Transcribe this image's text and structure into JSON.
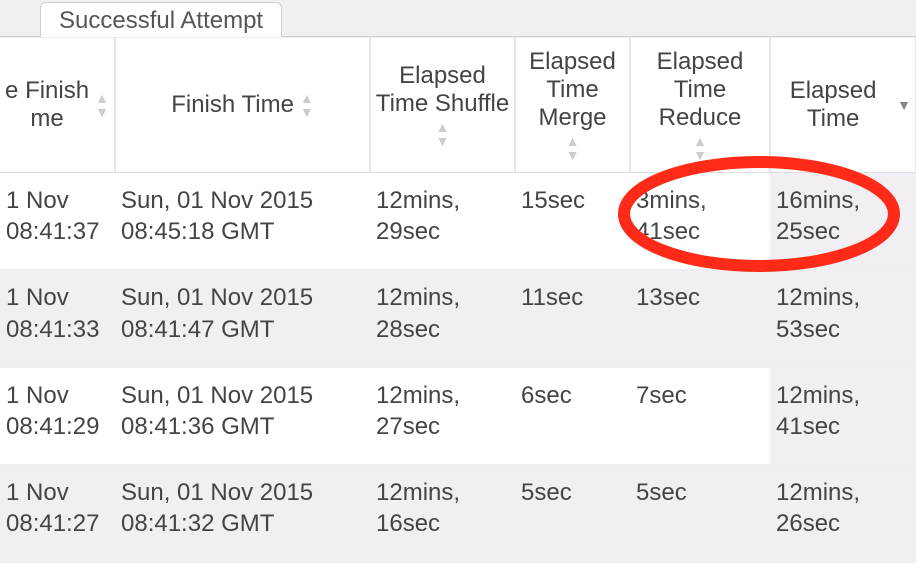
{
  "tab": {
    "label": "Successful Attempt"
  },
  "columns": {
    "c0": "e Finish\nme",
    "c1": "Finish Time",
    "c2": "Elapsed Time Shuffle",
    "c3": "Elapsed Time Merge",
    "c4": "Elapsed Time Reduce",
    "c5": "Elapsed Time"
  },
  "rows": [
    {
      "merge_finish": "1 Nov 08:41:37",
      "finish": "Sun, 01 Nov 2015 08:45:18 GMT",
      "shuffle": "12mins, 29sec",
      "merge": "15sec",
      "reduce": "3mins, 41sec",
      "elapsed": "16mins, 25sec"
    },
    {
      "merge_finish": "1 Nov 08:41:33",
      "finish": "Sun, 01 Nov 2015 08:41:47 GMT",
      "shuffle": "12mins, 28sec",
      "merge": "11sec",
      "reduce": "13sec",
      "elapsed": "12mins, 53sec"
    },
    {
      "merge_finish": "1 Nov 08:41:29",
      "finish": "Sun, 01 Nov 2015 08:41:36 GMT",
      "shuffle": "12mins, 27sec",
      "merge": "6sec",
      "reduce": "7sec",
      "elapsed": "12mins, 41sec"
    },
    {
      "merge_finish": "1 Nov 08:41:27",
      "finish": "Sun, 01 Nov 2015 08:41:32 GMT",
      "shuffle": "12mins, 16sec",
      "merge": "5sec",
      "reduce": "5sec",
      "elapsed": "12mins, 26sec"
    }
  ],
  "annotation": {
    "circle_color": "#ff2a17"
  }
}
